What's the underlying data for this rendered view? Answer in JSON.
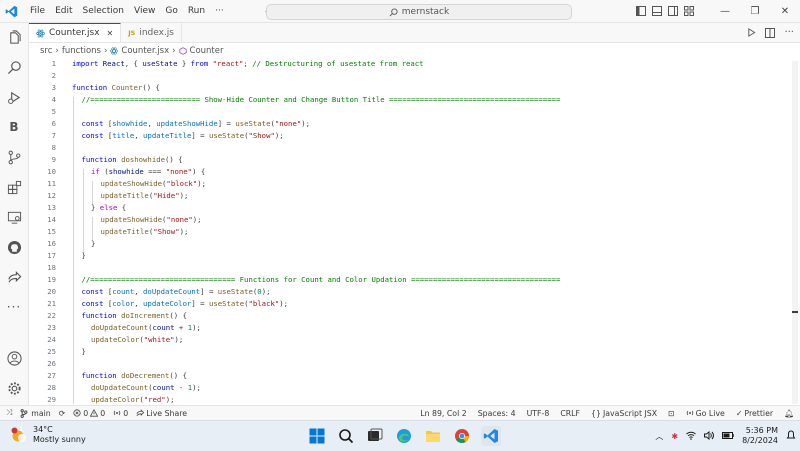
{
  "titlebar": {
    "menus": [
      "File",
      "Edit",
      "Selection",
      "View",
      "Go",
      "Run",
      "···"
    ],
    "nav_back": "←",
    "nav_forward": "→",
    "search_text": "mernstack",
    "win_min": "—",
    "win_max": "❐",
    "win_close": "✕"
  },
  "tabs": [
    {
      "label": "Counter.jsx",
      "close": "✕",
      "active": true
    },
    {
      "label": "index.js",
      "badge": "JS",
      "active": false
    }
  ],
  "breadcrumb": {
    "items": [
      "src",
      "functions",
      "Counter.jsx",
      "Counter"
    ],
    "sep": "›"
  },
  "editor": {
    "lines": [
      {
        "n": "1",
        "indent": 0,
        "text": "import React, { useState } from \"react\"; // Destructuring of usestate from react"
      },
      {
        "n": "2",
        "indent": 0,
        "text": ""
      },
      {
        "n": "3",
        "indent": 0,
        "text": "function Counter() {"
      },
      {
        "n": "4",
        "indent": 1,
        "text": "//========================= Show-Hide Counter and Change Button Title ======================================="
      },
      {
        "n": "5",
        "indent": 0,
        "text": ""
      },
      {
        "n": "6",
        "indent": 1,
        "text": "const [showhide, updateShowHide] = useState(\"none\");"
      },
      {
        "n": "7",
        "indent": 1,
        "text": "const [title, updateTitle] = useState(\"Show\");"
      },
      {
        "n": "8",
        "indent": 0,
        "text": ""
      },
      {
        "n": "9",
        "indent": 1,
        "text": "function doshowhide() {"
      },
      {
        "n": "10",
        "indent": 2,
        "text": "if (showhide === \"none\") {"
      },
      {
        "n": "11",
        "indent": 3,
        "text": "updateShowHide(\"block\");"
      },
      {
        "n": "12",
        "indent": 3,
        "text": "updateTitle(\"Hide\");"
      },
      {
        "n": "13",
        "indent": 2,
        "text": "} else {"
      },
      {
        "n": "14",
        "indent": 3,
        "text": "updateShowHide(\"none\");"
      },
      {
        "n": "15",
        "indent": 3,
        "text": "updateTitle(\"Show\");"
      },
      {
        "n": "16",
        "indent": 2,
        "text": "}"
      },
      {
        "n": "17",
        "indent": 1,
        "text": "}"
      },
      {
        "n": "18",
        "indent": 0,
        "text": ""
      },
      {
        "n": "19",
        "indent": 1,
        "text": "//================================= Functions for Count and Color Updation =================================="
      },
      {
        "n": "20",
        "indent": 1,
        "text": "const [count, doUpdateCount] = useState(0);"
      },
      {
        "n": "21",
        "indent": 1,
        "text": "const [color, updateColor] = useState(\"black\");"
      },
      {
        "n": "22",
        "indent": 1,
        "text": "function doIncrement() {"
      },
      {
        "n": "23",
        "indent": 2,
        "text": "doUpdateCount(count + 1);"
      },
      {
        "n": "24",
        "indent": 2,
        "text": "updateColor(\"white\");"
      },
      {
        "n": "25",
        "indent": 1,
        "text": "}"
      },
      {
        "n": "26",
        "indent": 0,
        "text": ""
      },
      {
        "n": "27",
        "indent": 1,
        "text": "function doDecrement() {"
      },
      {
        "n": "28",
        "indent": 2,
        "text": "doUpdateCount(count - 1);"
      },
      {
        "n": "29",
        "indent": 2,
        "text": "updateColor(\"red\");"
      }
    ]
  },
  "statusbar": {
    "branch": "main",
    "errors": "0",
    "warnings": "0",
    "ports": "0",
    "live_share": "Live Share",
    "position": "Ln 89, Col 2",
    "spaces": "Spaces: 4",
    "encoding": "UTF-8",
    "eol": "CRLF",
    "language": "JavaScript JSX",
    "go_live": "Go Live",
    "prettier": "Prettier"
  },
  "taskbar": {
    "weather_badge": "1",
    "temperature": "34°C",
    "weather_desc": "Mostly sunny",
    "time": "5:36 PM",
    "date": "8/2/2024"
  },
  "colors": {
    "keyword": "#0000ff",
    "control": "#af00db",
    "function": "#795e26",
    "variable": "#001080",
    "const_var": "#0070c1",
    "string": "#a31515",
    "comment": "#008000",
    "number": "#098658",
    "accent": "#005fb8"
  }
}
